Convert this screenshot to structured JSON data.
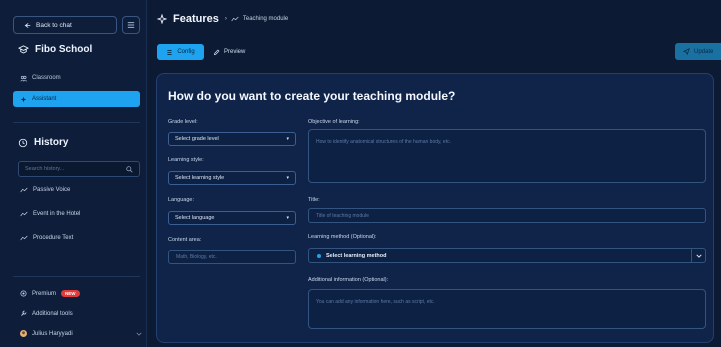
{
  "sidebar": {
    "back_label": "Back to chat",
    "school": "Fibo School",
    "nav": [
      {
        "label": "Classroom",
        "icon": "classroom-icon"
      },
      {
        "label": "Assistant",
        "icon": "assistant-icon",
        "active": true
      }
    ],
    "history_title": "History",
    "search_placeholder": "Search history...",
    "history_items": [
      "Passive Voice",
      "Event in the Hotel",
      "Procedure Text"
    ],
    "premium_label": "Premium",
    "premium_badge": "NEW",
    "additional_tools": "Additional tools",
    "user_name": "Julius Haryyadi"
  },
  "header": {
    "title": "Features",
    "breadcrumb": "Teaching module"
  },
  "tabs": {
    "config": "Config",
    "preview": "Preview",
    "update": "Update"
  },
  "form": {
    "title": "How do you want to create your teaching module?",
    "grade_label": "Grade level:",
    "grade_value": "Select grade level",
    "style_label": "Learning style:",
    "style_value": "Select learning style",
    "language_label": "Language:",
    "language_value": "Select language",
    "content_label": "Content area:",
    "content_placeholder": "Math, Biology, etc.",
    "objective_label": "Objective of learning:",
    "objective_placeholder": "How to identify anatomical structures of the human body, etc.",
    "title_label": "Title:",
    "title_placeholder": "Title of teaching module",
    "method_label": "Learning method (Optional):",
    "method_value": "Select learning method",
    "additional_label": "Additional information (Optional):",
    "additional_placeholder": "You can add any information here, such as script, etc."
  },
  "colors": {
    "accent": "#1ea3f0",
    "background": "#0c1a33",
    "card": "#10244a",
    "badge": "#e23a3a"
  }
}
